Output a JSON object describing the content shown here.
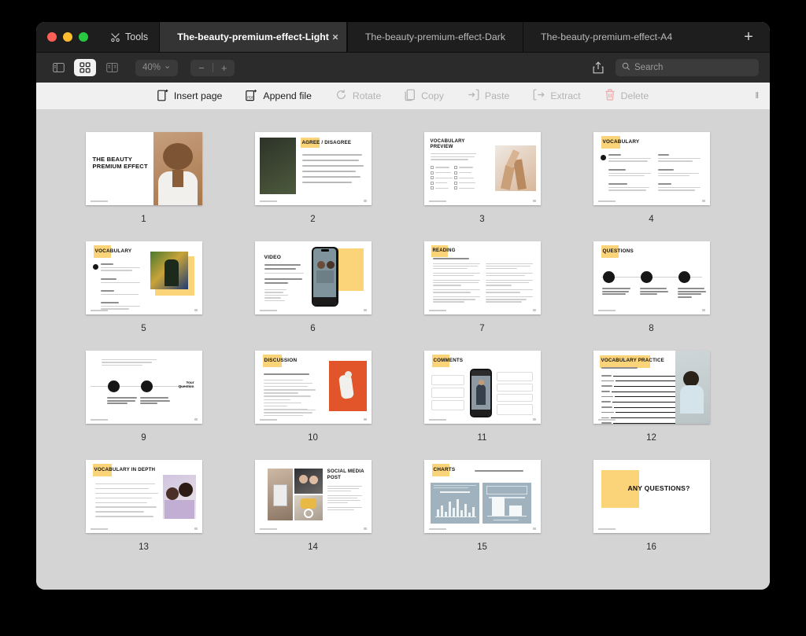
{
  "window": {
    "traffic_lights": [
      "close",
      "minimize",
      "zoom"
    ],
    "tools_label": "Tools",
    "new_tab_label": "+"
  },
  "tabs": [
    {
      "label": "The-beauty-premium-effect-Light",
      "active": true,
      "closable": true,
      "close_label": "×"
    },
    {
      "label": "The-beauty-premium-effect-Dark",
      "active": false,
      "closable": false,
      "close_label": ""
    },
    {
      "label": "The-beauty-premium-effect-A4",
      "active": false,
      "closable": false,
      "close_label": ""
    }
  ],
  "toolbar": {
    "sidebar_icon": "sidebar-toggle-icon",
    "thumbnails_icon": "thumbnail-grid-icon",
    "twopage_icon": "two-page-view-icon",
    "zoom_value": "40%",
    "zoom_caret": "⌄",
    "zoom_out": "−",
    "zoom_in": "+",
    "share_icon": "share-icon",
    "search_placeholder": "Search",
    "search_value": ""
  },
  "actionbar": {
    "items": [
      {
        "label": "Insert page",
        "icon": "insert-page-icon",
        "enabled": true
      },
      {
        "label": "Append file",
        "icon": "append-file-icon",
        "enabled": true
      },
      {
        "label": "Rotate",
        "icon": "rotate-icon",
        "enabled": false
      },
      {
        "label": "Copy",
        "icon": "copy-icon",
        "enabled": false
      },
      {
        "label": "Paste",
        "icon": "paste-icon",
        "enabled": false
      },
      {
        "label": "Extract",
        "icon": "extract-icon",
        "enabled": false
      },
      {
        "label": "Delete",
        "icon": "trash-icon",
        "enabled": false
      }
    ],
    "grip": "‖"
  },
  "colors": {
    "accent_yellow": "#fbd378",
    "accent_orange": "#e2552a",
    "chart_slate": "#9fb2bd",
    "window_dark": "#1e1e1e",
    "canvas_gray": "#d4d4d4"
  },
  "pages": [
    {
      "number": "1",
      "title": "THE BEAUTY PREMIUM EFFECT",
      "kind": "cover"
    },
    {
      "number": "2",
      "title": "AGREE / DISAGREE",
      "kind": "image-left-list-right"
    },
    {
      "number": "3",
      "title": "VOCABULARY PREVIEW",
      "kind": "checklist-image"
    },
    {
      "number": "4",
      "title": "VOCABULARY",
      "kind": "two-column-defs"
    },
    {
      "number": "5",
      "title": "VOCABULARY",
      "kind": "defs-image-right"
    },
    {
      "number": "6",
      "title": "VIDEO",
      "kind": "video-phone"
    },
    {
      "number": "7",
      "title": "READING",
      "kind": "two-column-text"
    },
    {
      "number": "8",
      "title": "QUESTIONS",
      "kind": "three-node-timeline"
    },
    {
      "number": "9",
      "title": "",
      "kind": "two-node-timeline"
    },
    {
      "number": "10",
      "title": "DISCUSSION",
      "kind": "list-orange-image"
    },
    {
      "number": "11",
      "title": "COMMENTS",
      "kind": "comments-phone"
    },
    {
      "number": "12",
      "title": "VOCABULARY PRACTICE",
      "kind": "worksheet-lines"
    },
    {
      "number": "13",
      "title": "VOCABULARY IN DEPTH",
      "kind": "numbered-list-image"
    },
    {
      "number": "14",
      "title": "SOCIAL MEDIA POST",
      "kind": "photo-collage"
    },
    {
      "number": "15",
      "title": "CHARTS",
      "kind": "charts"
    },
    {
      "number": "16",
      "title": "ANY QUESTIONS?",
      "kind": "closing"
    }
  ],
  "page_subtitles": {
    "p3": "Put a tick in the box next to the words you're familiar with and provide a brief explanation for each. Then, discuss the collocation words on the next page.",
    "p6": "10 Mind-Blowing Facts About Attractive People",
    "p7": "Read and answer the questions on the next page",
    "p9": "Your Question",
    "p10": "According to the video, attractive people",
    "p12": "Write an example sentence with each word",
    "p15": "Explore and discuss the data presented in the charts"
  }
}
